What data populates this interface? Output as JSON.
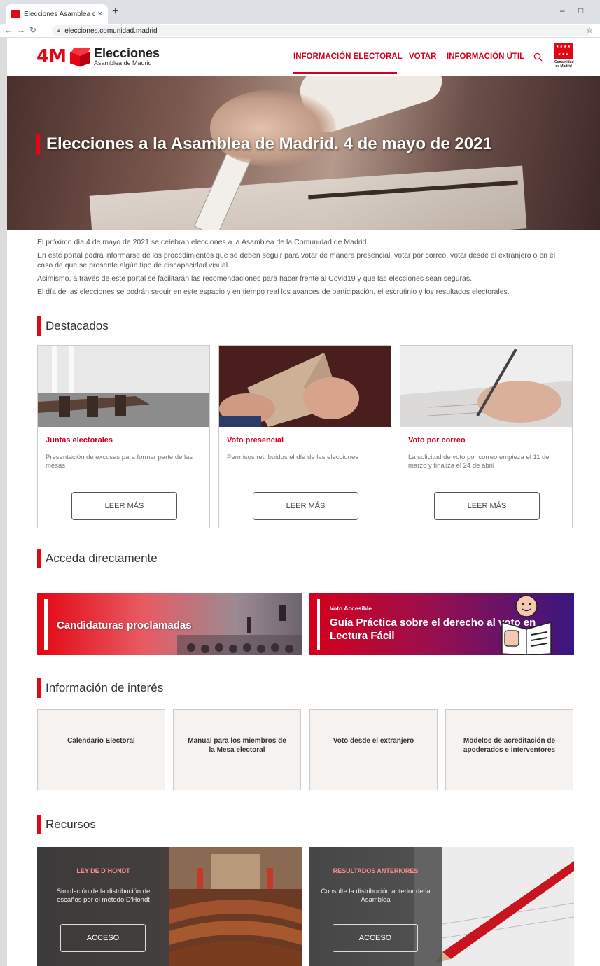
{
  "browser": {
    "tab_title": "Elecciones Asamblea de Madrid",
    "tab_close": "×",
    "new_tab": "+",
    "url": "elecciones.comunidad.madrid",
    "window_minimize": "–",
    "window_maximize": "□"
  },
  "header": {
    "logo_4m": "4M",
    "logo_title": "Elecciones",
    "logo_subtitle": "Asamblea de Madrid",
    "nav": [
      {
        "label": "INFORMACIÓN ELECTORAL",
        "active": true
      },
      {
        "label": "VOTAR",
        "active": false
      },
      {
        "label": "INFORMACIÓN ÚTIL",
        "active": false
      }
    ],
    "cm_logo_text": "Comunidad de Madrid",
    "accent_color": "#d5001c"
  },
  "hero": {
    "title": "Elecciones a la Asamblea de Madrid. 4 de mayo de 2021"
  },
  "intro": [
    "El próximo día 4 de mayo de 2021 se celebran elecciones a la Asamblea de la Comunidad de Madrid.",
    "En este portal podrá informarse de los procedimientos que se deben seguir para votar de manera presencial, votar por correo, votar desde el extranjero o en el caso de que se presente algún tipo de discapacidad visual.",
    "Asimismo, a través de este portal se facilitarán las recomendaciones para hacer frente al Covid19 y que las elecciones sean seguras.",
    "El día de las elecciones se podrán seguir en este espacio y en tiempo real los avances de participación, el escrutinio y los resultados electorales."
  ],
  "destacados": {
    "title": "Destacados",
    "cards": [
      {
        "title": "Juntas electorales",
        "desc": "Presentación de excusas para formar parte de las mesas",
        "button": "LEER MÁS"
      },
      {
        "title": "Voto presencial",
        "desc": "Permisos retribuidos el día de las elecciones",
        "button": "LEER MÁS"
      },
      {
        "title": "Voto por correo",
        "desc": "La solicitud de voto por correo empieza el 11 de marzo y finaliza el 24 de abril",
        "button": "LEER MÁS"
      }
    ]
  },
  "acceda": {
    "title": "Acceda directamente",
    "banner_left": "Candidaturas proclamadas",
    "banner_right_kicker": "Voto Accesible",
    "banner_right_title": "Guía Práctica sobre el derecho al voto en Lectura Fácil"
  },
  "interes": {
    "title": "Información de interés",
    "items": [
      "Calendario Electoral",
      "Manual para los miembros de la Mesa electoral",
      "Voto desde el extranjero",
      "Modelos de acreditación de apoderados e interventores"
    ]
  },
  "recursos": {
    "title": "Recursos",
    "items": [
      {
        "title": "LEY DE D`HONDT",
        "desc": "Simulación de la distribución de escaños por el método D'Hondt",
        "button": "ACCESO"
      },
      {
        "title": "RESULTADOS ANTERIORES",
        "desc": "Consulte la distribución anterior de la Asamblea",
        "button": "ACCESO"
      }
    ]
  }
}
